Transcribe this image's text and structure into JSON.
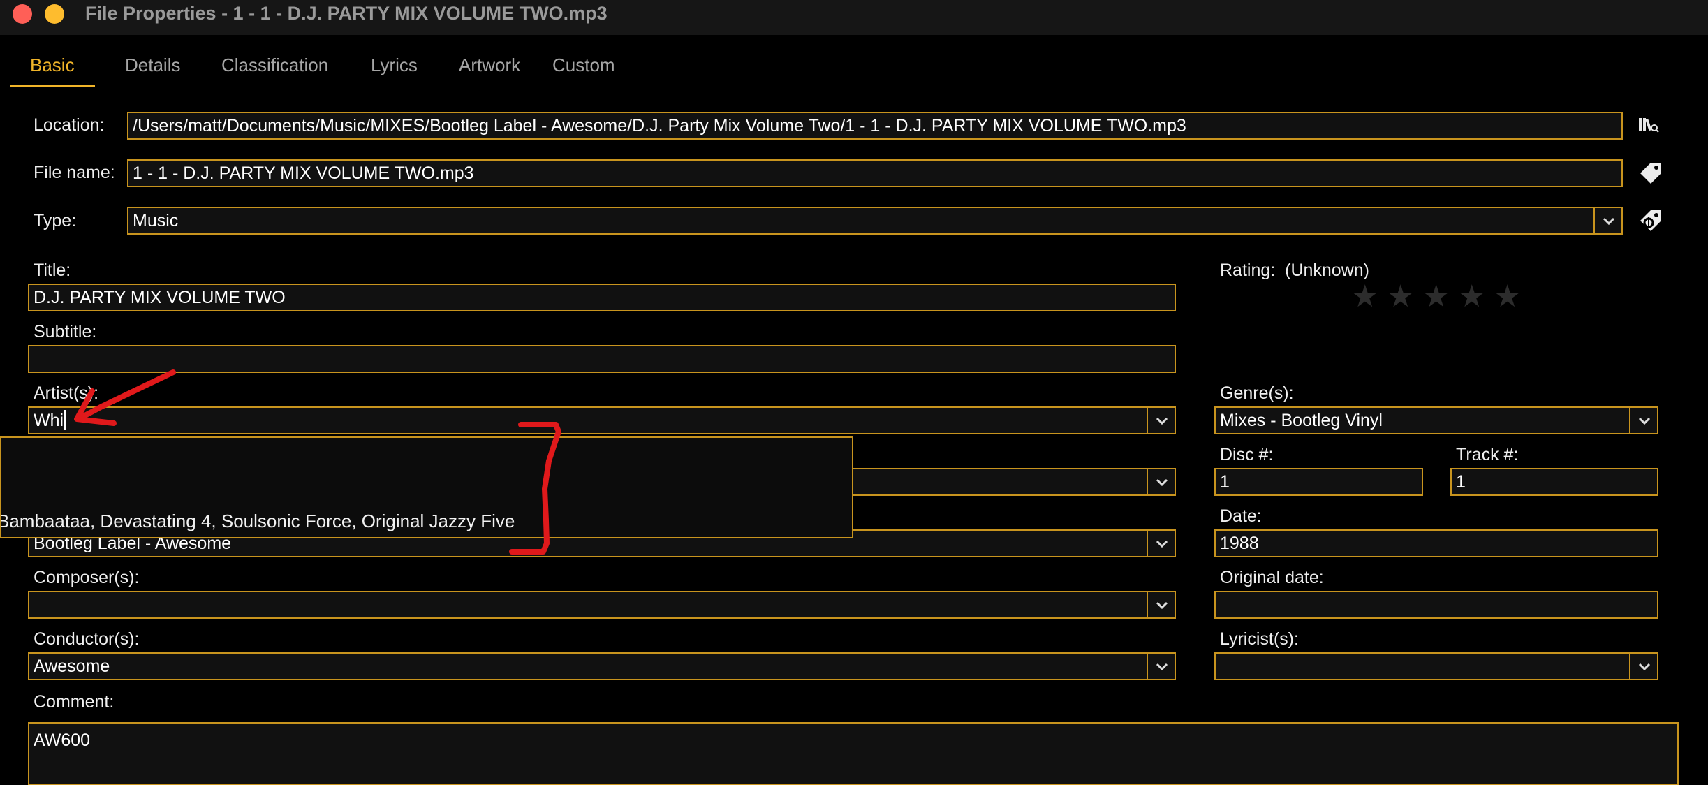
{
  "window": {
    "title": "File Properties - 1 - 1 - D.J. PARTY MIX VOLUME TWO.mp3"
  },
  "tabs": [
    {
      "label": "Basic",
      "active": true
    },
    {
      "label": "Details"
    },
    {
      "label": "Classification"
    },
    {
      "label": "Lyrics"
    },
    {
      "label": "Artwork"
    },
    {
      "label": "Custom"
    }
  ],
  "location": {
    "label": "Location:",
    "value": "/Users/matt/Documents/Music/MIXES/Bootleg Label - Awesome/D.J. Party Mix Volume Two/1 - 1 - D.J. PARTY MIX VOLUME TWO.mp3",
    "icon": "library-icon"
  },
  "filename": {
    "label": "File name:",
    "value": "1 - 1 - D.J. PARTY MIX VOLUME TWO.mp3",
    "icon": "tag-icon"
  },
  "type": {
    "label": "Type:",
    "value": "Music",
    "icon": "auto-tag-icon"
  },
  "title": {
    "label": "Title:",
    "value": "D.J. PARTY MIX VOLUME TWO"
  },
  "subtitle": {
    "label": "Subtitle:",
    "value": ""
  },
  "artists": {
    "label": "Artist(s):",
    "value": "Whi"
  },
  "artist_suggestions": [
    "Bambaataa, Devastating 4, Soulsonic Force, Original Jazzy Five"
  ],
  "publisher": {
    "value": "Bootleg Label - Awesome"
  },
  "composers": {
    "label": "Composer(s):",
    "value": ""
  },
  "conductors": {
    "label": "Conductor(s):",
    "value": "Awesome"
  },
  "comment": {
    "label": "Comment:",
    "value": "AW600"
  },
  "rating": {
    "label": "Rating:",
    "value": "(Unknown)",
    "stars": 0,
    "max_stars": 5
  },
  "genres": {
    "label": "Genre(s):",
    "value": "Mixes - Bootleg Vinyl"
  },
  "disc": {
    "label": "Disc #:",
    "value": "1"
  },
  "track": {
    "label": "Track #:",
    "value": "1"
  },
  "date": {
    "label": "Date:",
    "value": "1988"
  },
  "original_date": {
    "label": "Original date:",
    "value": ""
  },
  "lyricists": {
    "label": "Lyricist(s):",
    "value": ""
  },
  "colors": {
    "accent": "#f0b429",
    "field_border": "#c8941e",
    "annotation": "#e0191b"
  }
}
